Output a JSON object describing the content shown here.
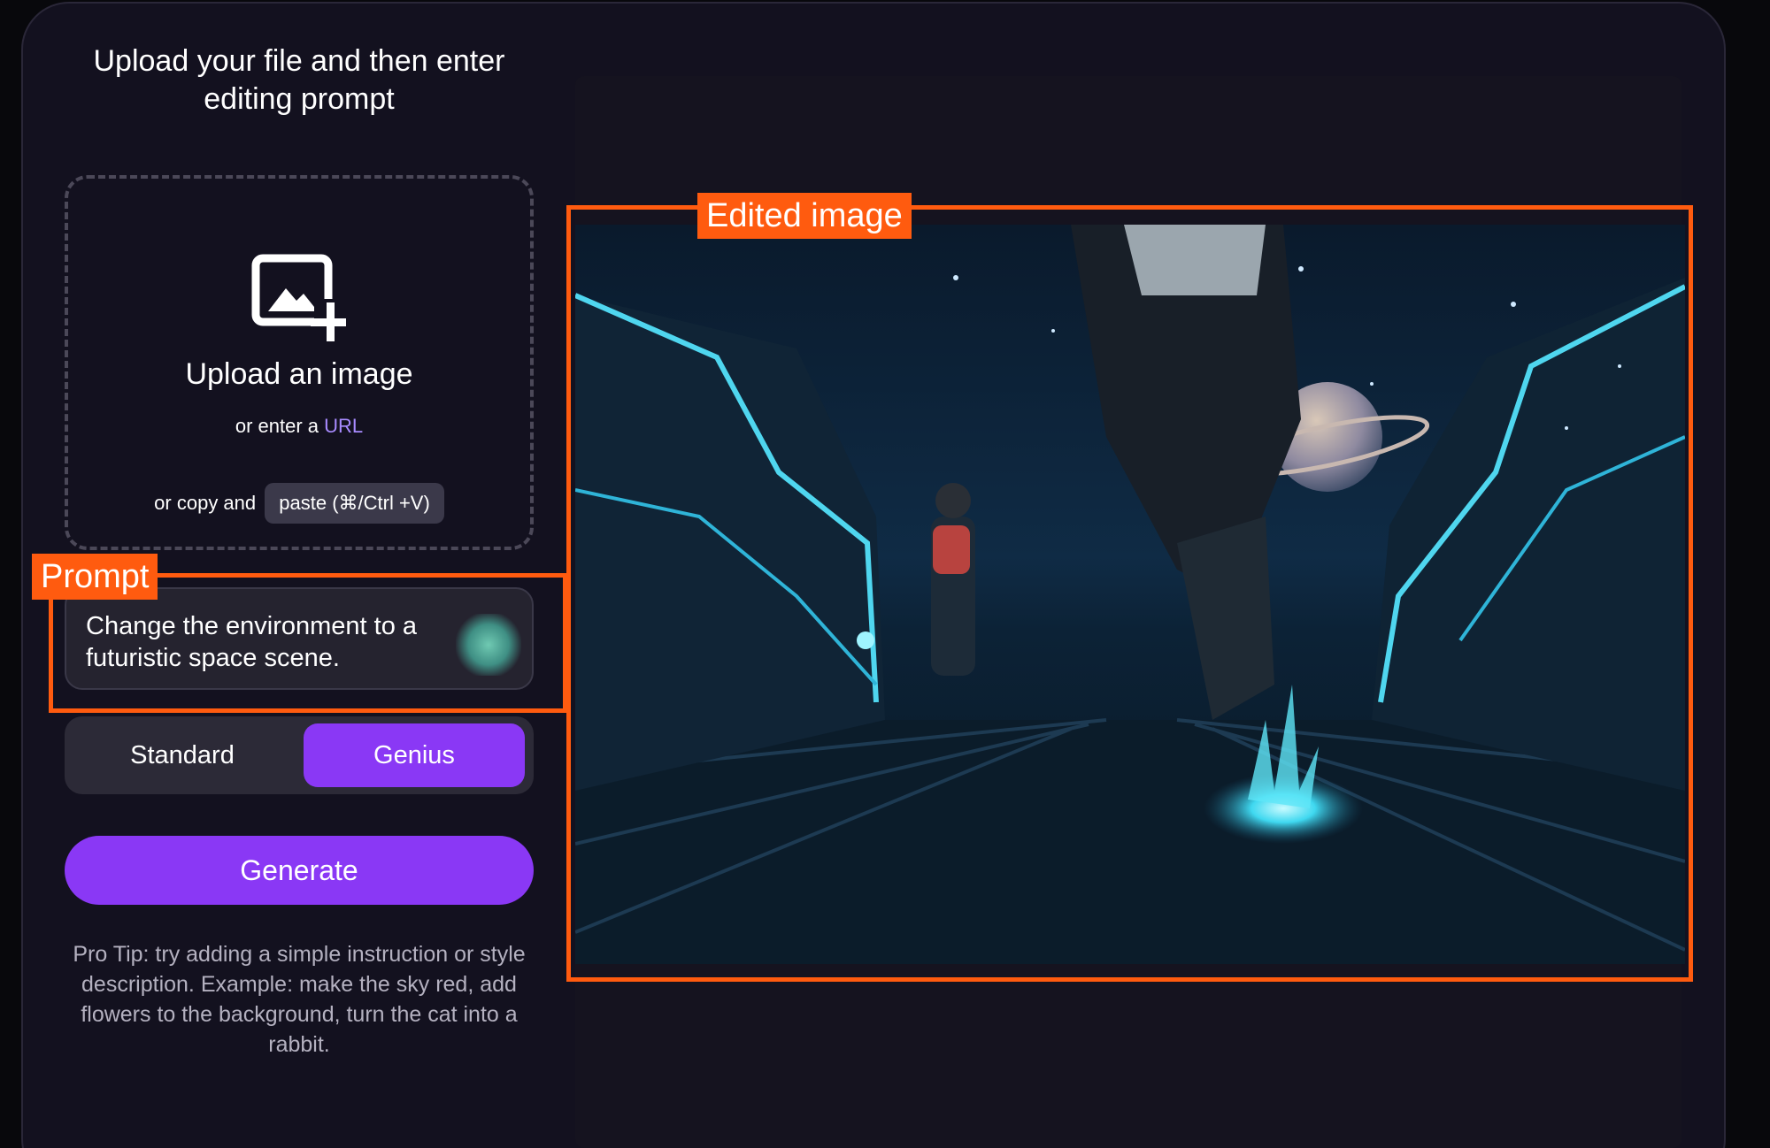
{
  "heading": "Upload your file and then enter editing prompt",
  "upload": {
    "title": "Upload an image",
    "url_prefix": "or enter a",
    "url_link": "URL",
    "paste_prefix": "or copy and",
    "paste_key": "paste (⌘/Ctrl +V)",
    "icon": "image-add-icon"
  },
  "prompt": {
    "text": "Change the environment to a futuristic space scene."
  },
  "modes": {
    "standard": "Standard",
    "genius": "Genius",
    "selected": "Genius"
  },
  "generate_label": "Generate",
  "pro_tip": "Pro Tip: try adding a simple instruction or style description. Example: make the sky red, add flowers to the background, turn the cat into a rabbit.",
  "annotations": {
    "prompt_label": "Prompt",
    "image_label": "Edited image",
    "color": "#ff5b0f"
  },
  "colors": {
    "accent": "#8a38f5",
    "link": "#a88bff",
    "panel": "#13111f"
  }
}
